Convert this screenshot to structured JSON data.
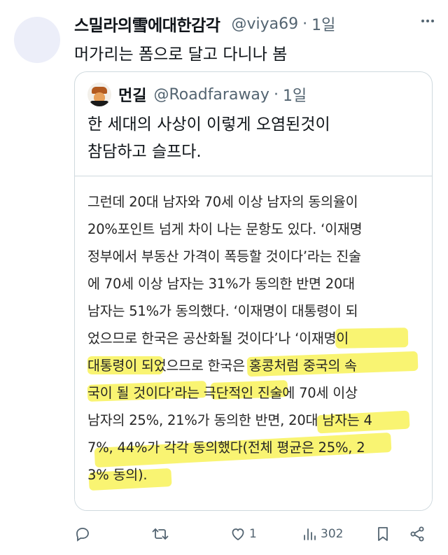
{
  "post": {
    "display_name": "스밀라의雪에대한감각",
    "handle": "@viya69",
    "separator": "·",
    "time": "1일",
    "text": "머가리는 폼으로 달고 다니나 봄"
  },
  "quote": {
    "display_name": "먼길",
    "handle": "@Roadfaraway",
    "separator": "·",
    "time": "1일",
    "text_lines": [
      "한 세대의 사상이 이렇게 오염된것이",
      "참담하고 슬프다."
    ],
    "article_lines": [
      "그런데 20대 남자와 70세 이상 남자의 동의율이",
      "20%포인트 넘게 차이 나는 문항도 있다. ‘이재명",
      "정부에서 부동산 가격이 폭등할 것이다’라는 진술",
      "에 70세 이상 남자는 31%가 동의한 반면 20대",
      "남자는 51%가 동의했다. ‘이재명이 대통령이 되",
      "었으므로 한국은 공산화될 것이다’나 ‘이재명이",
      "대통령이 되었으므로 한국은 홍콩처럼 중국의 속",
      "국이 될 것이다’라는 극단적인 진술에 70세 이상",
      "남자의 25%, 21%가 동의한 반면, 20대 남자는 4",
      "7%, 44%가 각각 동의했다(전체 평균은 25%, 2",
      "3% 동의)."
    ]
  },
  "actions": {
    "reply_icon": "reply-icon",
    "retweet_icon": "retweet-icon",
    "like_icon": "heart-icon",
    "like_count": "1",
    "views_icon": "views-icon",
    "views_count": "302",
    "bookmark_icon": "bookmark-icon",
    "share_icon": "share-icon"
  },
  "colors": {
    "text_primary": "#0f1419",
    "text_secondary": "#536471",
    "border": "#cfd9de",
    "highlight": "#f7f03c"
  }
}
